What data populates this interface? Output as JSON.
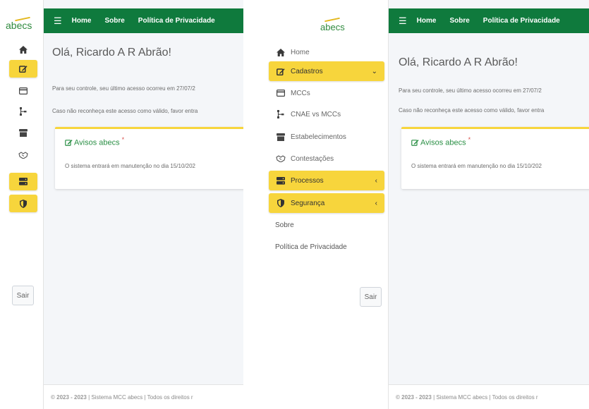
{
  "brand": {
    "logo": "abecs"
  },
  "topbar": {
    "nav": [
      "Home",
      "Sobre",
      "Política de Privacidade"
    ]
  },
  "sidebar": {
    "items": [
      {
        "label": "Home",
        "icon": "home-icon"
      },
      {
        "label": "Cadastros",
        "icon": "edit-icon",
        "chevron": "⌄"
      },
      {
        "label": "MCCs",
        "icon": "card-icon"
      },
      {
        "label": "CNAE vs MCCs",
        "icon": "sitemap-icon"
      },
      {
        "label": "Estabelecimentos",
        "icon": "store-icon"
      },
      {
        "label": "Contestações",
        "icon": "handshake-icon"
      },
      {
        "label": "Processos",
        "icon": "server-icon",
        "chevron": "‹"
      },
      {
        "label": "Segurança",
        "icon": "shield-icon",
        "chevron": "‹"
      }
    ],
    "links": [
      "Sobre",
      "Política de Privacidade"
    ],
    "logout": "Sair"
  },
  "main": {
    "greeting": "Olá, Ricardo A R Abrão!",
    "last_access_left": "Para seu controle, seu último acesso ocorreu em 27/07/2",
    "last_access_right": "Para seu controle, seu último acesso ocorreu em 27/07/2",
    "warning_left": "Caso não reconheça este acesso como válido, favor entra",
    "warning_right": "Caso não reconheça este acesso como válido, favor entra",
    "notice_title": "Avisos abecs",
    "notice_required": "*",
    "notice_text": "O sistema entrará em manutenção no dia 15/10/202"
  },
  "footer": {
    "years": "© 2023 - 2023",
    "separator": "|",
    "text_left": "Sistema MCC abecs | Todos os direitos r",
    "text_right": "Sistema MCC abecs | Todos os direitos r"
  },
  "colors": {
    "topbar": "#0f7a3d",
    "accent": "#f7d53c",
    "brand_green": "#2f8a3e",
    "link_green": "#2a8f45"
  }
}
